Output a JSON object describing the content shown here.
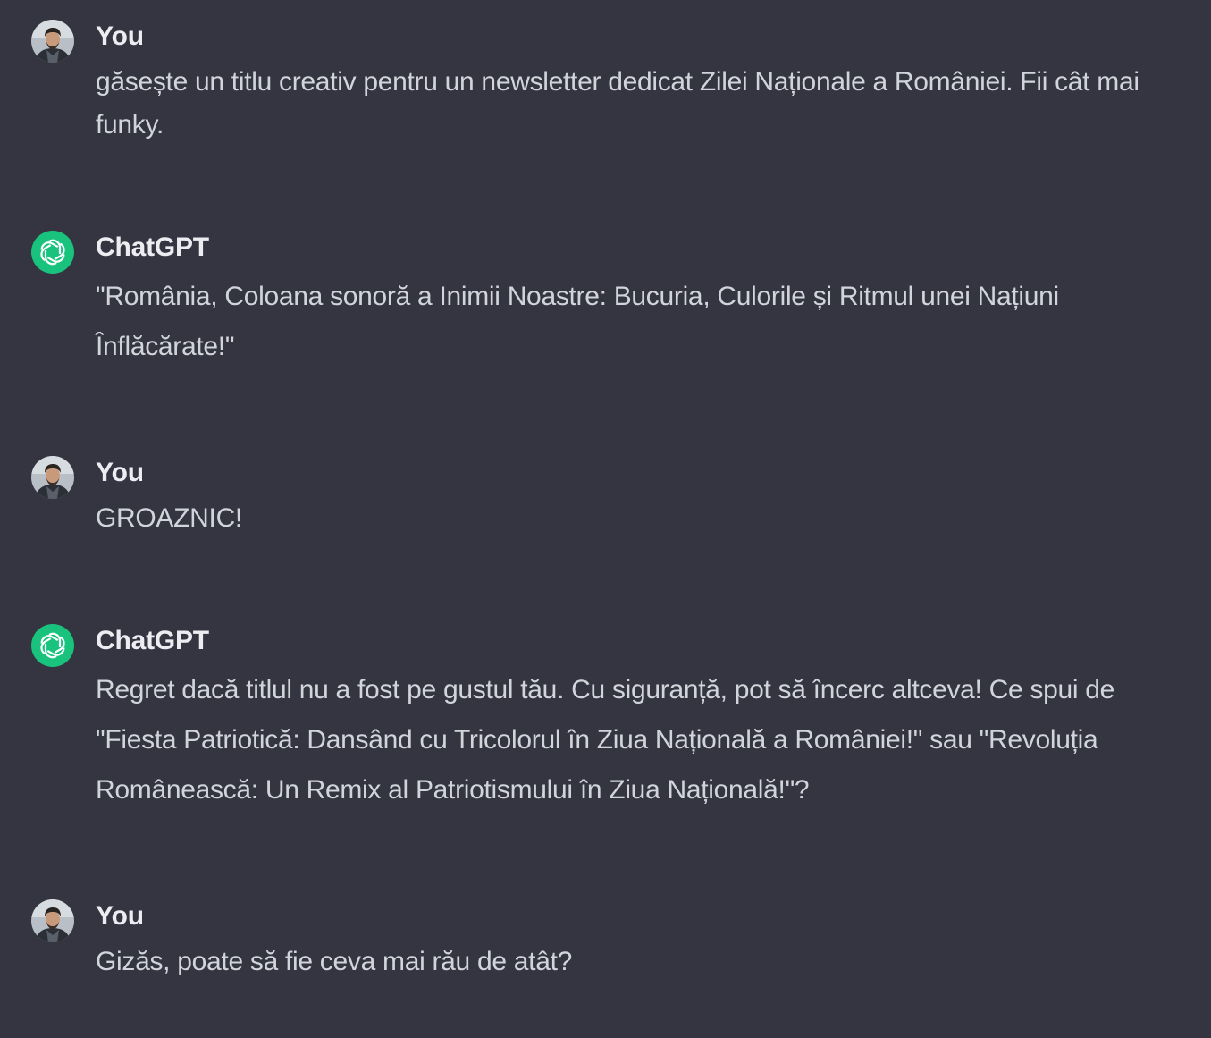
{
  "colors": {
    "background": "#343541",
    "author_text": "#ececf1",
    "message_text": "#d1d5db",
    "assistant_avatar_bg": "#19c37d"
  },
  "messages": [
    {
      "role": "user",
      "author": "You",
      "avatar_icon": "user-photo-avatar",
      "text": "găsește un titlu creativ pentru un newsletter dedicat Zilei Naționale a României. Fii cât mai funky."
    },
    {
      "role": "assistant",
      "author": "ChatGPT",
      "avatar_icon": "openai-logo-icon",
      "text": "\"România, Coloana sonoră a Inimii Noastre: Bucuria, Culorile și Ritmul unei Națiuni Înflăcărate!\""
    },
    {
      "role": "user",
      "author": "You",
      "avatar_icon": "user-photo-avatar",
      "text": "GROAZNIC!"
    },
    {
      "role": "assistant",
      "author": "ChatGPT",
      "avatar_icon": "openai-logo-icon",
      "text": "Regret dacă titlul nu a fost pe gustul tău. Cu siguranță, pot să încerc altceva! Ce spui de \"Fiesta Patriotică: Dansând cu Tricolorul în Ziua Națională a României!\" sau \"Revoluția Românească: Un Remix al Patriotismului în Ziua Națională!\"?"
    },
    {
      "role": "user",
      "author": "You",
      "avatar_icon": "user-photo-avatar",
      "text": "Gizăs, poate să fie ceva mai rău de atât?"
    }
  ]
}
